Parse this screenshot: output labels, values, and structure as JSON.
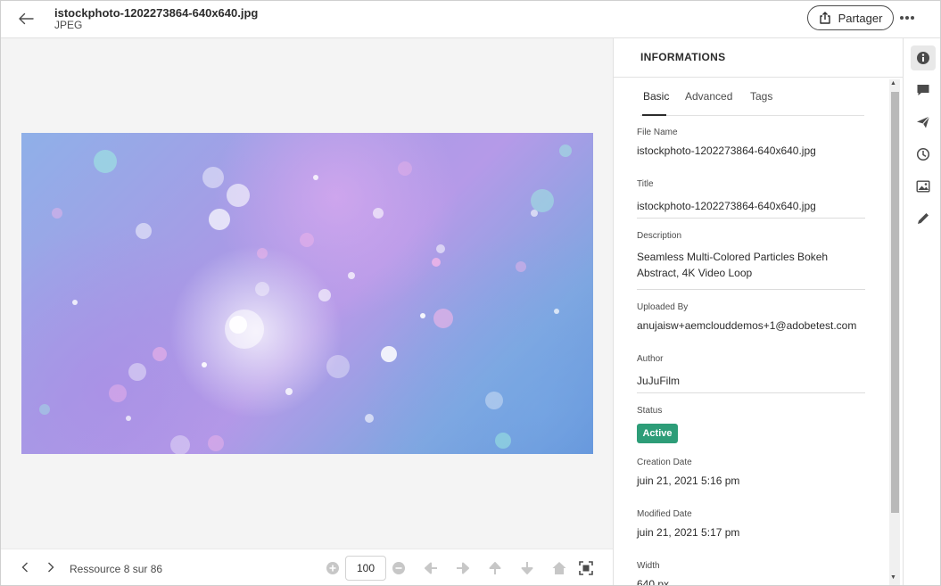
{
  "header": {
    "file_name": "istockphoto-1202273864-640x640.jpg",
    "file_type": "JPEG",
    "share_label": "Partager",
    "more_icon": "ellipsis-icon",
    "back_icon": "arrow-left-icon"
  },
  "footer": {
    "resource_count": "Ressource 8 sur 86",
    "zoom_value": "100"
  },
  "panel": {
    "title": "INFORMATIONS",
    "tabs": [
      "Basic",
      "Advanced",
      "Tags"
    ],
    "active_tab": "Basic",
    "fields": [
      {
        "label": "File Name",
        "value": "istockphoto-1202273864-640x640.jpg"
      },
      {
        "label": "Title",
        "value": "istockphoto-1202273864-640x640.jpg"
      },
      {
        "label": "Description",
        "value": "Seamless Multi-Colored Particles Bokeh Abstract, 4K Video Loop"
      },
      {
        "label": "Uploaded By",
        "value": "anujaisw+aemclouddemos+1@adobetest.com"
      },
      {
        "label": "Author",
        "value": "JuJuFilm"
      },
      {
        "label": "Status",
        "value": "Active"
      },
      {
        "label": "Creation Date",
        "value": "juin 21, 2021 5:16 pm"
      },
      {
        "label": "Modified Date",
        "value": "juin 21, 2021 5:17 pm"
      },
      {
        "label": "Width",
        "value": "640 px"
      }
    ]
  },
  "rail": {
    "icons": [
      "info-icon",
      "comment-icon",
      "send-icon",
      "history-icon",
      "image-icon",
      "pencil-icon"
    ],
    "active": "info-icon"
  },
  "colors": {
    "status_active": "#2d9d78",
    "text_primary": "#2c2c2c",
    "viewer_bg": "#f4f4f4"
  }
}
